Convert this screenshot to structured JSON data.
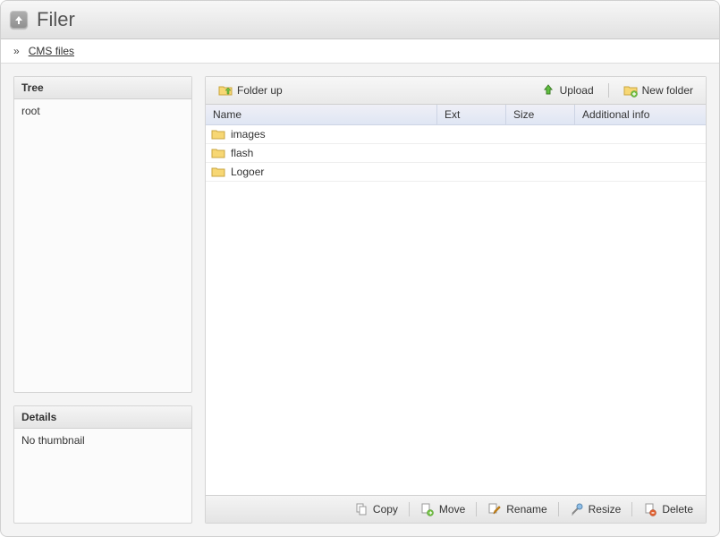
{
  "title": "Filer",
  "breadcrumb": {
    "sep": "»",
    "link": "CMS files"
  },
  "sidebar": {
    "tree_header": "Tree",
    "tree_root": "root",
    "details_header": "Details",
    "details_body": "No thumbnail"
  },
  "toolbar_top": {
    "folder_up": "Folder up",
    "upload": "Upload",
    "new_folder": "New folder"
  },
  "columns": {
    "name": "Name",
    "ext": "Ext",
    "size": "Size",
    "info": "Additional info"
  },
  "rows": [
    {
      "name": "images",
      "ext": "",
      "size": "",
      "info": ""
    },
    {
      "name": "flash",
      "ext": "",
      "size": "",
      "info": ""
    },
    {
      "name": "Logoer",
      "ext": "",
      "size": "",
      "info": ""
    }
  ],
  "toolbar_bottom": {
    "copy": "Copy",
    "move": "Move",
    "rename": "Rename",
    "resize": "Resize",
    "delete": "Delete"
  }
}
